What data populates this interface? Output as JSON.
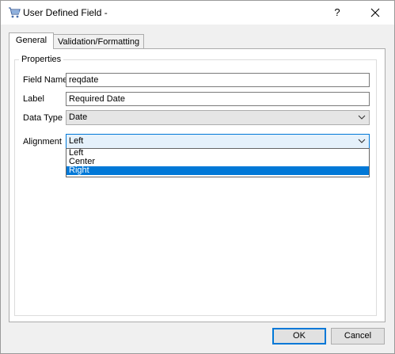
{
  "window": {
    "title": "User Defined Field -",
    "help_label": "?"
  },
  "tabs": [
    {
      "label": "General",
      "active": true
    },
    {
      "label": "Validation/Formatting",
      "active": false
    }
  ],
  "properties": {
    "group_title": "Properties",
    "field_name": {
      "label": "Field Name",
      "value": "reqdate"
    },
    "label_field": {
      "label": "Label",
      "value": "Required Date"
    },
    "data_type": {
      "label": "Data Type",
      "value": "Date"
    },
    "alignment": {
      "label": "Alignment",
      "value": "Left",
      "options": [
        "Left",
        "Center",
        "Right"
      ],
      "highlighted": "Right"
    }
  },
  "buttons": {
    "ok": "OK",
    "cancel": "Cancel"
  },
  "colors": {
    "accent": "#0078d7",
    "selection": "#0078d7"
  },
  "icons": {
    "app": "cart-icon",
    "close": "close-icon",
    "chevron": "chevron-down-icon"
  }
}
